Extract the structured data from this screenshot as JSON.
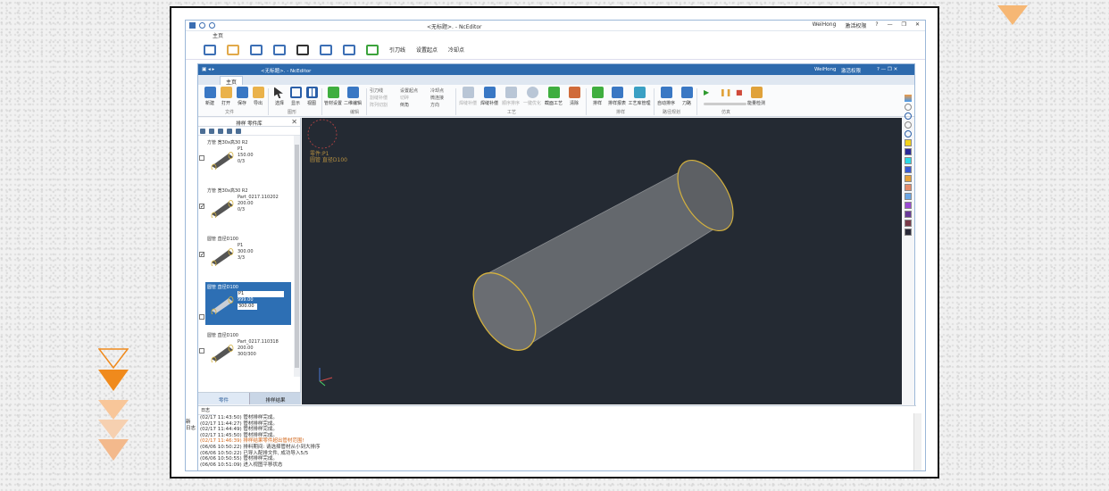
{
  "outer_window": {
    "title": "<无标题>. - NcEditor",
    "user": "WeiHong",
    "login": "激活权限",
    "help": "?",
    "tab": "主页",
    "toolbar": {
      "ref_line": "引刀线",
      "set_start": "设置起点",
      "cool_point": "冷却点"
    },
    "left_labels": [
      "新",
      "日志"
    ]
  },
  "inner_window": {
    "title": "<无标题>. - NcEditor",
    "user": "WeiHong",
    "login": "激活权限",
    "tab": "主页",
    "ribbon": {
      "file_group": "文件",
      "file_buttons": [
        "新建",
        "打开",
        "保存",
        "导出"
      ],
      "edit_group": "图形",
      "edit_buttons": [
        "选择",
        "显示",
        "视图"
      ],
      "draw_group": "编辑",
      "draw_buttons": [
        "管材设置",
        "二维编辑"
      ],
      "small_col1": [
        "引刀线",
        "割缝补偿",
        "阵列切割"
      ],
      "small_col2": [
        "设置起点",
        "切碎",
        "倒角"
      ],
      "small_col3": [
        "冷却点",
        "微连接",
        "方向"
      ],
      "craft_group": "工艺",
      "craft_buttons": [
        "焊缝补偿",
        "焊缝补偿",
        "顺序排序",
        "一键优化",
        "截面工艺",
        "清除"
      ],
      "layout_group": "排样",
      "layout_buttons": [
        "排样",
        "排样报表",
        "工艺库管理"
      ],
      "sort_group": "路径规划",
      "sort_buttons": [
        "自动排序",
        "刀路"
      ],
      "sim_group": "仿真",
      "right_buttons": [
        "能量检测"
      ]
    },
    "part_panel": {
      "title": "排样 零件库",
      "close": "✕",
      "items": [
        {
          "name": "方管 宽30x高30 R2",
          "id": "P1",
          "len": "150.00",
          "qty": "0/3",
          "checked": false,
          "selected": false
        },
        {
          "name": "方管 宽30x高30 R2",
          "id": "Part_0217.110202",
          "len": "200.00",
          "qty": "0/3",
          "checked": true,
          "selected": false
        },
        {
          "name": "圆管 直径D100",
          "id": "P1",
          "len": "300.00",
          "qty": "3/3",
          "checked": true,
          "selected": false
        },
        {
          "name": "圆管 直径D100",
          "id": "P1",
          "len": "999.00",
          "qty": "300.00",
          "checked": false,
          "selected": true
        },
        {
          "name": "圆管 直径D100",
          "id": "Part_0217.110318",
          "len": "200.00",
          "qty": "300/300",
          "checked": false,
          "selected": false
        }
      ],
      "tab_parts": "零件",
      "tab_result": "排样结果"
    },
    "viewport": {
      "part_line": "零件:P1",
      "spec_line": "圆管 直径D100",
      "tube_color": "#c9a63a",
      "bg_color": "#242a33"
    },
    "log": {
      "header": "日志",
      "lines": [
        "(02/17 11:43:50) 管材排样完成。",
        "(02/17 11:44:27) 管材排样完成。",
        "(02/17 11:44:49) 管材排样完成。",
        "(02/17 11:45:50) 管材排样完成。",
        "(02/17 11:46:39) 排样结果零件超出管材范围!",
        "(06/06 10:50:22) 排料期间: 请选择管材从小到大排序",
        "(06/06 10:50:22) 已导入配排文件, 成功导入5/5",
        "(06/06 10:50:55) 管材排样完成。",
        "(06/06 10:51:09) 进入视图平移状态"
      ]
    }
  }
}
